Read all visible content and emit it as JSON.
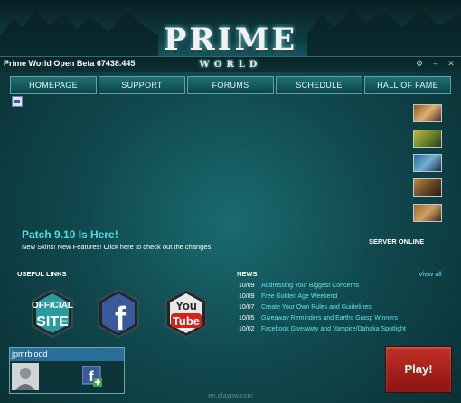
{
  "header": {
    "logo_main": "PRIME",
    "logo_sub": "WORLD"
  },
  "window": {
    "title": "Prime World Open Beta 67438.445",
    "controls": [
      "settings-gear",
      "minimize",
      "close"
    ]
  },
  "nav": {
    "tabs": [
      "HOMEPAGE",
      "SUPPORT",
      "FORUMS",
      "SCHEDULE",
      "HALL OF FAME"
    ]
  },
  "hero_thumbs": [
    "hero-1",
    "hero-2",
    "hero-3",
    "hero-4",
    "hero-5"
  ],
  "patch": {
    "title": "Patch 9.10 Is Here!",
    "description": "New Skins! New Features! Click here to check out the changes."
  },
  "server_status": "SERVER ONLINE",
  "useful_links": {
    "heading": "USEFUL LINKS",
    "official_site": {
      "line1": "OFFICIAL",
      "line2": "SITE"
    },
    "facebook": "f",
    "youtube": {
      "line1": "You",
      "line2": "Tube"
    }
  },
  "news": {
    "heading": "NEWS",
    "view_all": "View all",
    "items": [
      {
        "date": "10/09",
        "title": "Addressing Your Biggest Concerns"
      },
      {
        "date": "10/09",
        "title": "Free Golden Age Weekend"
      },
      {
        "date": "10/07",
        "title": "Create Your Own Rules and Guidelines"
      },
      {
        "date": "10/05",
        "title": "Giveaway Reminders and Earths Grasp Winners"
      },
      {
        "date": "10/02",
        "title": "Facebook Giveaway and Vampire/Dahaka Spotlight"
      }
    ]
  },
  "user": {
    "name": "jpmrblood",
    "fb_label": "f"
  },
  "play_label": "Play!",
  "footer_url": "en.playpw.com",
  "colors": {
    "accent": "#5ee6ee",
    "play": "#b2231b",
    "background": "#10494e"
  }
}
